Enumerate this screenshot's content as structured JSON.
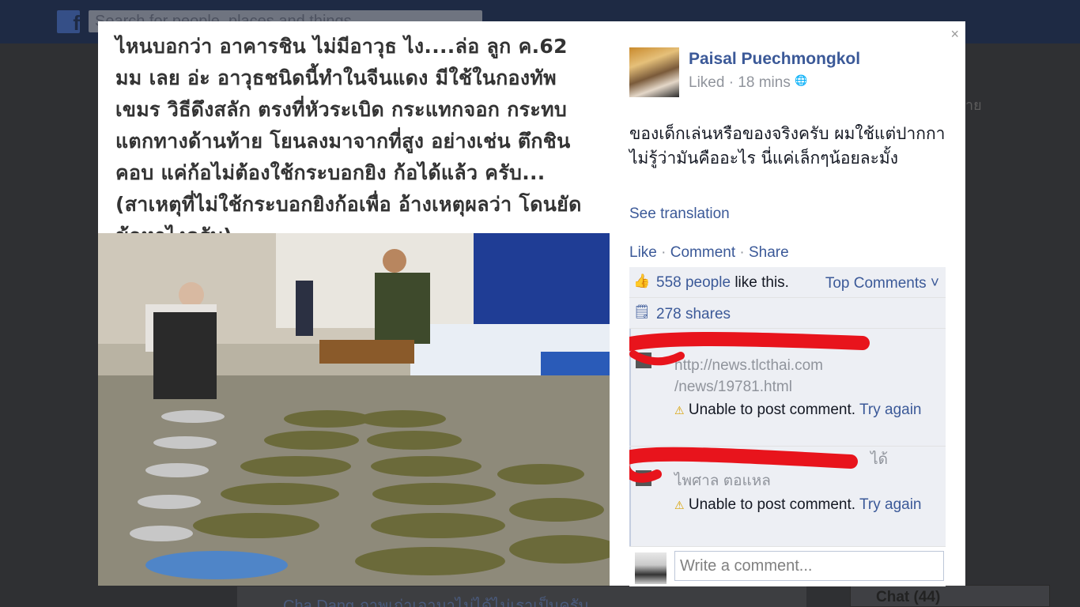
{
  "background": {
    "search_placeholder": "Search for people, places and things",
    "bottom_post_text": "Cha Dang ภาพเก่าเอามาไม่ได้ไม่เราเป็นครับ",
    "chat_label": "Chat (44)",
    "side_text": "าย"
  },
  "post": {
    "author": "Paisal Puechmongkol",
    "meta_status": "Liked",
    "meta_time": "18 mins",
    "text": "ของเด็กเล่นหรือของจริงครับ ผมใช้แต่ปากกาไม่รู้ว่ามันคืออะไร นี่แค่เล็กๆน้อยละมั้ง",
    "see_translation": "See translation",
    "actions": {
      "like": "Like",
      "comment": "Comment",
      "share": "Share"
    },
    "photo_caption": "ไหนบอกว่า อาคารชิน ไม่มีอาวุธ ไง....ล่อ ลูก ค.62 มม เลย อ่ะ อาวุธชนิดนี้ทำในจีนแดง มีใช้ในกองทัพเขมร วิธีดึงสลัก ตรงที่หัวระเบิด กระแทกจอก กระทบแตกทางด้านท้าย โยนลงมาจากที่สูง อย่างเช่น ตึกชินคอบ แค่ก้อไม่ต้องใช้กระบอกยิง ก้อได้แล้ว ครับ... (สาเหตุที่ไม่ใช้กระบอกยิงก้อเพื่อ อ้างเหตุผลว่า โดนยัดข้อหาไงครับ)"
  },
  "ufi": {
    "likes_count": "558 people",
    "likes_suffix": " like this.",
    "top_comments": "Top Comments ˅",
    "shares": "278 shares",
    "comments": [
      {
        "text_line1": "http://news.tlcthai.com",
        "text_line2": "/news/19781.html",
        "error": "Unable to post comment.",
        "retry": "Try again"
      },
      {
        "text_line1": "ได้",
        "text_line2": "ไพศาล ตอแหล",
        "error": "Unable to post comment.",
        "retry": "Try again"
      }
    ],
    "write_placeholder": "Write a comment..."
  },
  "close_label": "×"
}
